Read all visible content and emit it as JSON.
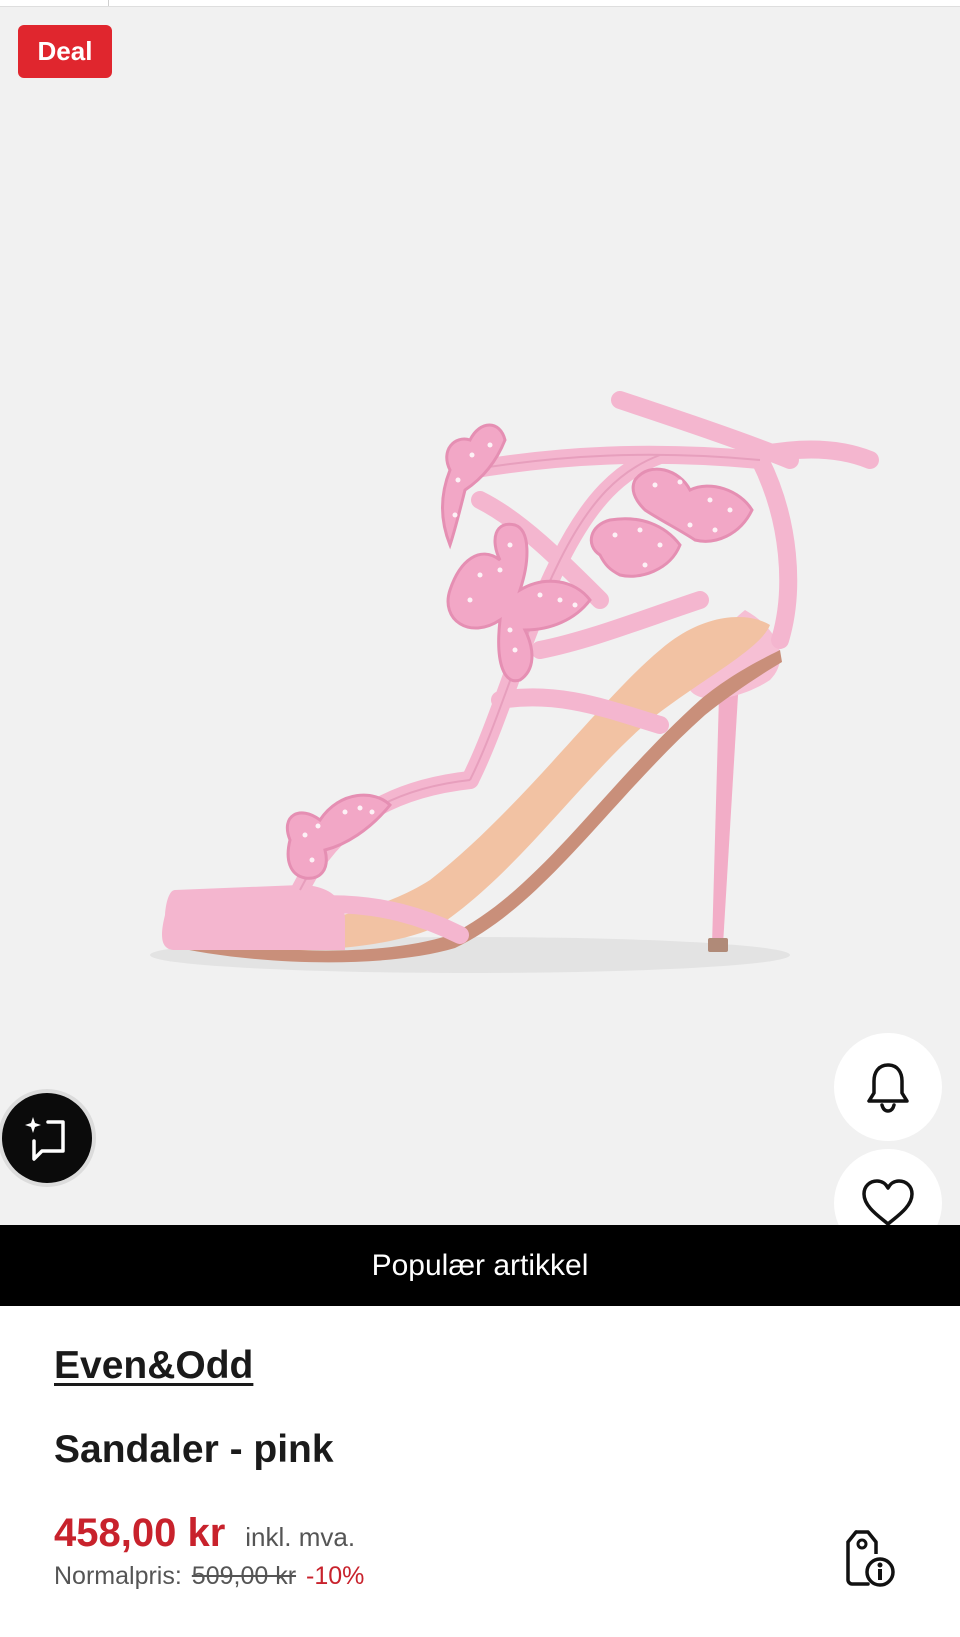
{
  "hero": {
    "badge": "Deal",
    "image_alt": "Rosa sandal med sommerfugler",
    "icons": {
      "bell": "bell-icon",
      "heart": "heart-icon",
      "ai": "sparkle-chat-icon"
    }
  },
  "banner": {
    "text": "Populær artikkel"
  },
  "product": {
    "brand": "Even&Odd",
    "name": "Sandaler - pink",
    "price": "458,00 kr",
    "vat_note": "inkl. mva.",
    "normal_label": "Normalpris:",
    "normal_price": "509,00 kr",
    "discount": "-10%",
    "price_info_icon": "price-tag-info-icon"
  },
  "colors": {
    "deal_red": "#e0262e",
    "price_red": "#c8222c",
    "sandal_pink": "#f4b6cf",
    "insole": "#f2c2a3"
  }
}
